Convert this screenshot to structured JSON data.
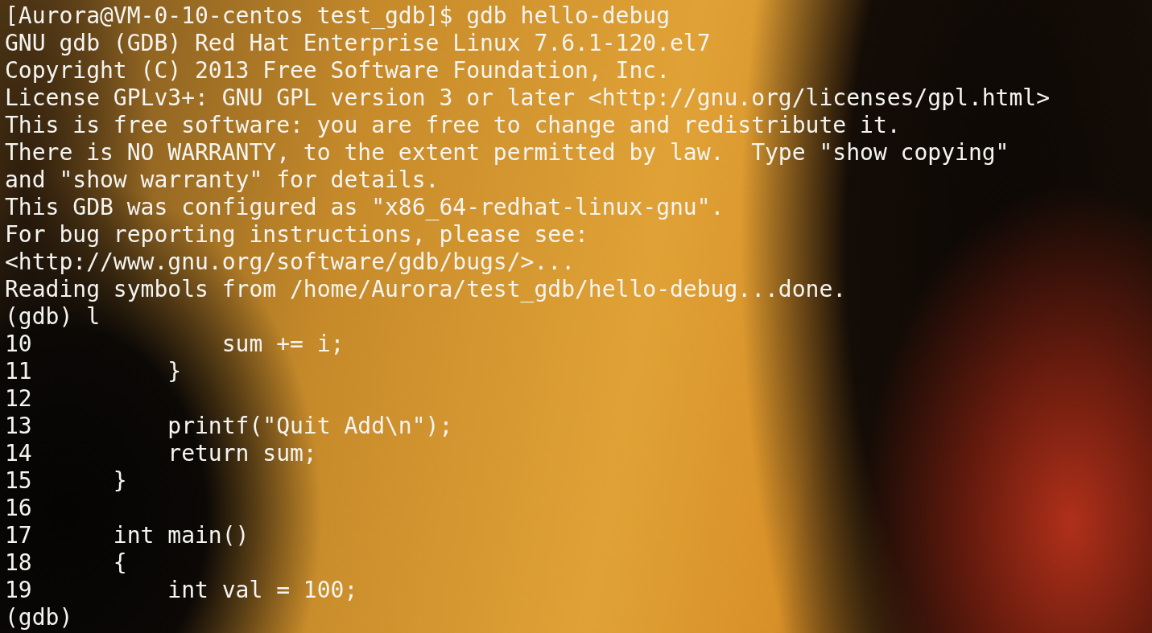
{
  "terminal": {
    "lines": [
      "[Aurora@VM-0-10-centos test_gdb]$ gdb hello-debug",
      "GNU gdb (GDB) Red Hat Enterprise Linux 7.6.1-120.el7",
      "Copyright (C) 2013 Free Software Foundation, Inc.",
      "License GPLv3+: GNU GPL version 3 or later <http://gnu.org/licenses/gpl.html>",
      "This is free software: you are free to change and redistribute it.",
      "There is NO WARRANTY, to the extent permitted by law.  Type \"show copying\"",
      "and \"show warranty\" for details.",
      "This GDB was configured as \"x86_64-redhat-linux-gnu\".",
      "For bug reporting instructions, please see:",
      "<http://www.gnu.org/software/gdb/bugs/>...",
      "Reading symbols from /home/Aurora/test_gdb/hello-debug...done.",
      "(gdb) l",
      "10              sum += i;",
      "11          }",
      "12",
      "13          printf(\"Quit Add\\n\");",
      "14          return sum;",
      "15      }",
      "16",
      "17      int main()",
      "18      {",
      "19          int val = 100;",
      "(gdb)"
    ]
  }
}
